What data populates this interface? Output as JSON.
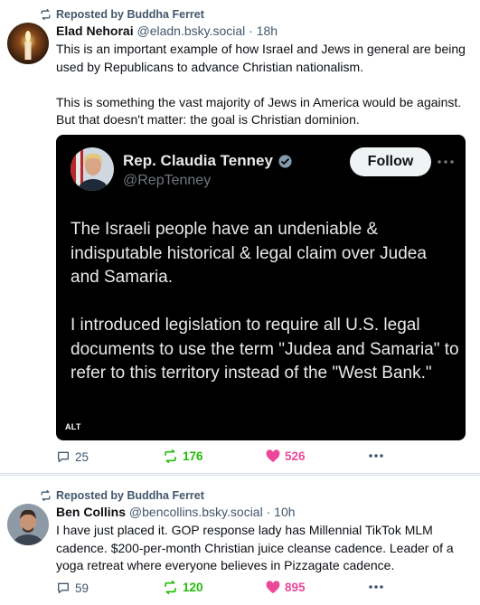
{
  "posts": [
    {
      "repost_label": "Reposted by Buddha Ferret",
      "author_name": "Elad Nehorai",
      "author_handle": "@eladn.bsky.social",
      "time": "18h",
      "text": [
        "This is an important example of how Israel and Jews in general are being used by Republicans to advance Christian nationalism.",
        "This is something the vast majority of Jews in America would be against. But that doesn't matter: the goal is Christian dominion."
      ],
      "embed": {
        "name": "Rep. Claudia Tenney",
        "handle": "@RepTenney",
        "follow_label": "Follow",
        "text": [
          "The Israeli people have an undeniable & indisputable historical & legal claim over Judea and Samaria.",
          "I introduced legislation to require all U.S. legal documents to use the term \"Judea and Samaria\" to refer to this territory instead of the \"West Bank.\""
        ],
        "alt_badge": "ALT"
      },
      "counts": {
        "replies": "25",
        "reposts": "176",
        "likes": "526"
      }
    },
    {
      "repost_label": "Reposted by Buddha Ferret",
      "author_name": "Ben Collins",
      "author_handle": "@bencollins.bsky.social",
      "time": "10h",
      "text": [
        "I have just placed it. GOP response lady has Millennial TikTok MLM cadence. $200-per-month Christian juice cleanse cadence. Leader of a yoga retreat where everyone believes in Pizzagate cadence."
      ],
      "counts": {
        "replies": "59",
        "reposts": "120",
        "likes": "895"
      }
    }
  ],
  "icons": {
    "repost": "repost-icon",
    "reply": "reply-icon",
    "like": "heart-icon",
    "more": "more-dots-icon",
    "verified": "verified-badge-icon"
  },
  "colors": {
    "muted": "#42576c",
    "repost_active": "#20bc07",
    "like_active": "#ec4899",
    "divider": "#d4dbe2",
    "embed_bg": "#000000"
  }
}
